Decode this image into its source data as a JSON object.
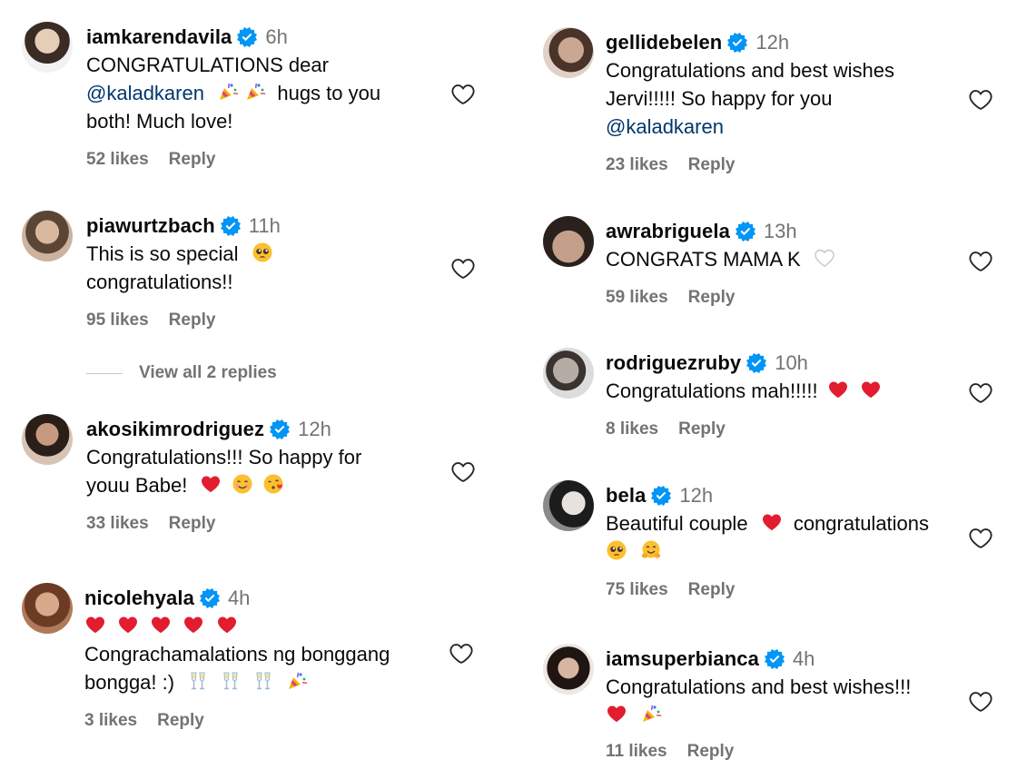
{
  "left": [
    {
      "username": "iamkarendavila",
      "time": "6h",
      "lines": [
        "CONGRATULATIONS dear",
        "@kaladkaren",
        "both! Much love!"
      ],
      "line2_rest": "hugs to you",
      "likes": "52 likes",
      "reply": "Reply",
      "avatar_color": "#c9a88f"
    },
    {
      "username": "piawurtzbach",
      "time": "11h",
      "lines": [
        "This is so special",
        "congratulations!!"
      ],
      "likes": "95 likes",
      "reply": "Reply",
      "avatar_color": "#b89478"
    },
    {
      "username": "akosikimrodriguez",
      "time": "12h",
      "lines": [
        "Congratulations!!! So happy for",
        "youu Babe!"
      ],
      "likes": "33 likes",
      "reply": "Reply",
      "avatar_color": "#8a6a57"
    },
    {
      "username": "nicolehyala",
      "time": "4h",
      "lines": [
        "Congrachamalations ng bonggang",
        "bongga! :)"
      ],
      "likes": "3 likes",
      "reply": "Reply",
      "avatar_color": "#9b6b50"
    }
  ],
  "view_replies": "View all 2 replies",
  "right": [
    {
      "username": "gellidebelen",
      "time": "12h",
      "lines": [
        "Congratulations and best wishes",
        "Jervi!!!!! So happy for you",
        "@kaladkaren"
      ],
      "likes": "23 likes",
      "reply": "Reply",
      "avatar_color": "#a98b78"
    },
    {
      "username": "awrabriguela",
      "time": "13h",
      "lines": [
        "CONGRATS MAMA K"
      ],
      "likes": "59 likes",
      "reply": "Reply",
      "avatar_color": "#6f5645"
    },
    {
      "username": "rodriguezruby",
      "time": "10h",
      "lines": [
        "Congratulations mah!!!!!"
      ],
      "likes": "8 likes",
      "reply": "Reply",
      "avatar_color": "#b9b5b2"
    },
    {
      "username": "bela",
      "time": "12h",
      "lines": [
        "Beautiful couple",
        "congratulations"
      ],
      "likes": "75 likes",
      "reply": "Reply",
      "avatar_color": "#555555"
    },
    {
      "username": "iamsuperbianca",
      "time": "4h",
      "lines": [
        "Congratulations and best wishes!!!"
      ],
      "likes": "11 likes",
      "reply": "Reply",
      "avatar_color": "#5a3e34"
    }
  ],
  "colors": {
    "verified": "#0095f6",
    "heart_red": "#ed1c33",
    "muted": "#737373"
  }
}
